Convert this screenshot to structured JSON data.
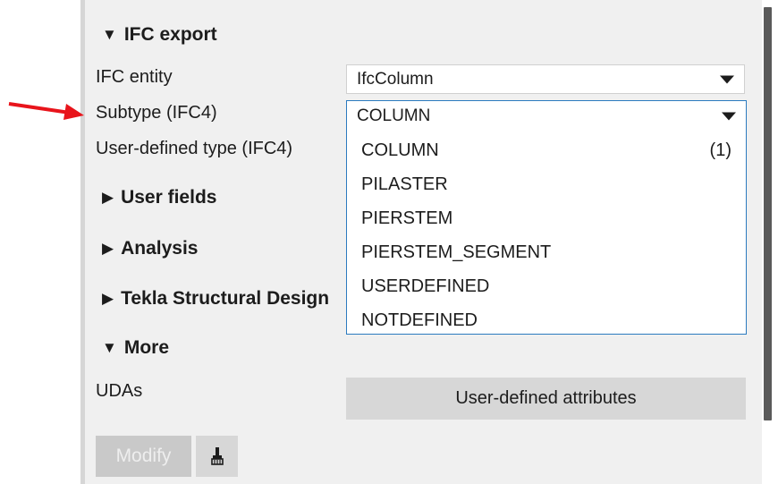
{
  "sections": {
    "ifc_export": "IFC export",
    "user_fields": "User fields",
    "analysis": "Analysis",
    "tekla_design": "Tekla Structural Design",
    "more": "More"
  },
  "fields": {
    "ifc_entity_label": "IFC entity",
    "ifc_entity_value": "IfcColumn",
    "subtype_label": "Subtype (IFC4)",
    "subtype_value": "COLUMN",
    "user_defined_label": "User-defined type (IFC4)",
    "udas_label": "UDAs"
  },
  "subtype_options": [
    {
      "label": "COLUMN",
      "count": "(1)"
    },
    {
      "label": "PILASTER",
      "count": ""
    },
    {
      "label": "PIERSTEM",
      "count": ""
    },
    {
      "label": "PIERSTEM_SEGMENT",
      "count": ""
    },
    {
      "label": "USERDEFINED",
      "count": ""
    },
    {
      "label": "NOTDEFINED",
      "count": ""
    }
  ],
  "buttons": {
    "uda_button": "User-defined attributes",
    "modify": "Modify"
  },
  "icons": {
    "collapse": "triangle-down-icon",
    "expand": "triangle-right-icon",
    "brush": "brush-icon",
    "annotation_arrow": "red-arrow-icon"
  },
  "colors": {
    "annotation_arrow": "#e8141b",
    "dropdown_border": "#2b7bbf",
    "panel_bg": "#f0f0f0",
    "scrollbar": "#5a5a5a"
  }
}
